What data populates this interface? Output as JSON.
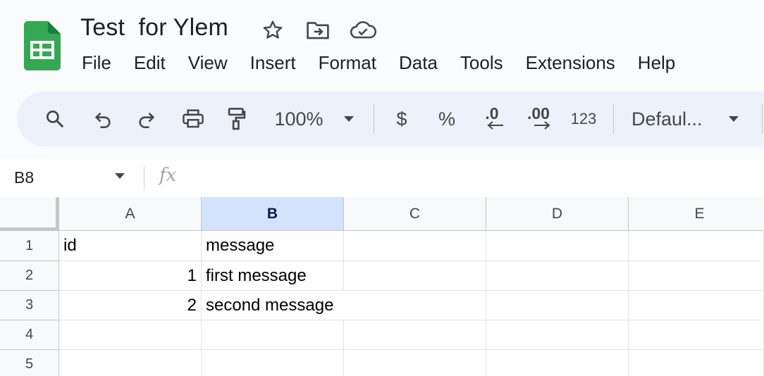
{
  "doc": {
    "title": "Test  for Ylem"
  },
  "menu": [
    "File",
    "Edit",
    "View",
    "Insert",
    "Format",
    "Data",
    "Tools",
    "Extensions",
    "Help"
  ],
  "toolbar": {
    "zoom": "100%",
    "currency": "$",
    "percent": "%",
    "decrease_decimal": ".0",
    "increase_decimal": ".00",
    "number_format": "123",
    "font": "Defaul..."
  },
  "formula_bar": {
    "name_box": "B8",
    "fx": "fx"
  },
  "grid": {
    "columns": [
      "A",
      "B",
      "C",
      "D",
      "E"
    ],
    "selected_column": "B",
    "rows": [
      "1",
      "2",
      "3",
      "4",
      "5"
    ],
    "cells": {
      "A1": "id",
      "B1": "message",
      "A2": "1",
      "B2": "first message",
      "A3": "2",
      "B3": "second message"
    }
  },
  "colors": {
    "sheets_green": "#188038",
    "toolbar_bg": "#edf2fa",
    "selected_header": "#d3e3fd"
  }
}
